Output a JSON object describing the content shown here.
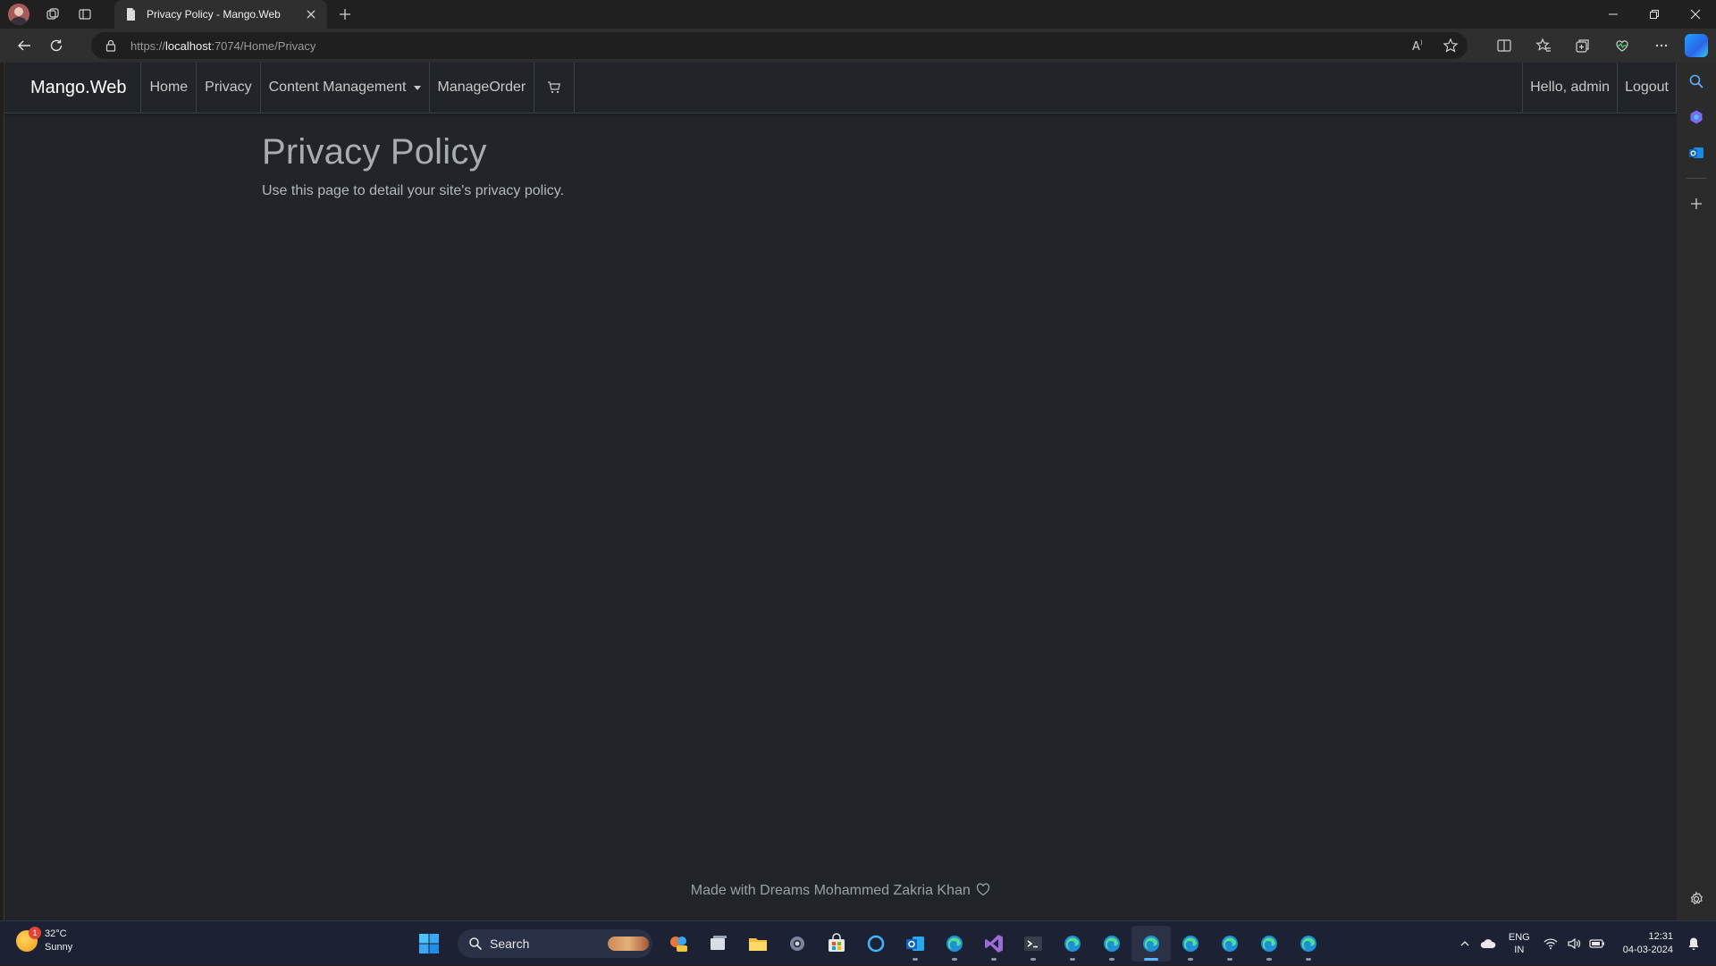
{
  "browser": {
    "tab_title": "Privacy Policy - Mango.Web",
    "url_scheme": "https://",
    "url_host": "localhost",
    "url_path": ":7074/Home/Privacy"
  },
  "navbar": {
    "brand": "Mango.Web",
    "items": [
      {
        "label": "Home"
      },
      {
        "label": "Privacy"
      },
      {
        "label": "Content Management"
      },
      {
        "label": "ManageOrder"
      }
    ],
    "greeting": "Hello, admin",
    "logout": "Logout"
  },
  "page": {
    "title": "Privacy Policy",
    "description": "Use this page to detail your site's privacy policy."
  },
  "footer": {
    "text": "Made with Dreams Mohammed Zakria Khan"
  },
  "taskbar": {
    "weather_temp": "32°C",
    "weather_desc": "Sunny",
    "weather_badge": "1",
    "search_label": "Search",
    "lang_line1": "ENG",
    "lang_line2": "IN",
    "time": "12:31",
    "date": "04-03-2024"
  },
  "colors": {
    "page_bg": "#212529",
    "browser_chrome": "#202020",
    "taskbar_bg": "#1c2233",
    "accent": "#5fb2ff"
  }
}
